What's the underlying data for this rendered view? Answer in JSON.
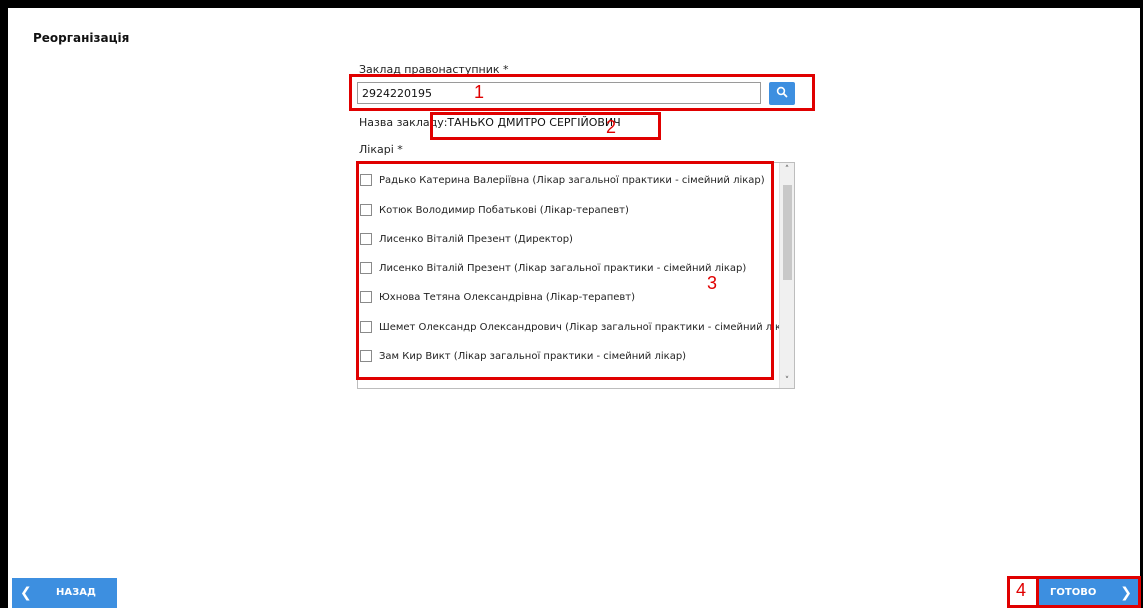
{
  "page": {
    "title": "Реорганізація"
  },
  "successor": {
    "label": "Заклад правонаступник *",
    "value": "2924220195"
  },
  "facility": {
    "label": "Назва закладу:",
    "value": "ТАНЬКО ДМИТРО СЕРГІЙОВИЧ"
  },
  "doctors": {
    "label": "Лікарі *",
    "items": [
      {
        "label": "Радько Катерина Валеріївна (Лікар загальної практики - сімейний лікар)",
        "checked": false
      },
      {
        "label": "Котюк Володимир Побатькові (Лікар-терапевт)",
        "checked": false
      },
      {
        "label": "Лисенко Віталій Презент (Директор)",
        "checked": false
      },
      {
        "label": "Лисенко Віталій Презент (Лікар загальної практики - сімейний лікар)",
        "checked": false
      },
      {
        "label": "Юхнова Тетяна Олександрівна (Лікар-терапевт)",
        "checked": false
      },
      {
        "label": "Шемет Олександр Олександрович (Лікар загальної практики - сімейний лікар)",
        "checked": false
      },
      {
        "label": "Зам Кир Викт (Лікар загальної практики - сімейний лікар)",
        "checked": false
      }
    ]
  },
  "icons": {
    "search": "search-icon",
    "back": "chevron-left-icon",
    "forward": "chevron-right-icon",
    "scroll_up": "chevron-up-icon",
    "scroll_down": "chevron-down-icon"
  },
  "scroll_glyphs": {
    "up": "˄",
    "down": "˅"
  },
  "nav": {
    "back_label": "НАЗАД",
    "done_label": "ГОТОВО",
    "back_glyph": "❮",
    "done_glyph": "❯"
  },
  "annotations": {
    "n1": "1",
    "n2": "2",
    "n3": "3",
    "n4": "4"
  },
  "colors": {
    "accent": "#3d8fe0",
    "annotation": "#e00000"
  }
}
